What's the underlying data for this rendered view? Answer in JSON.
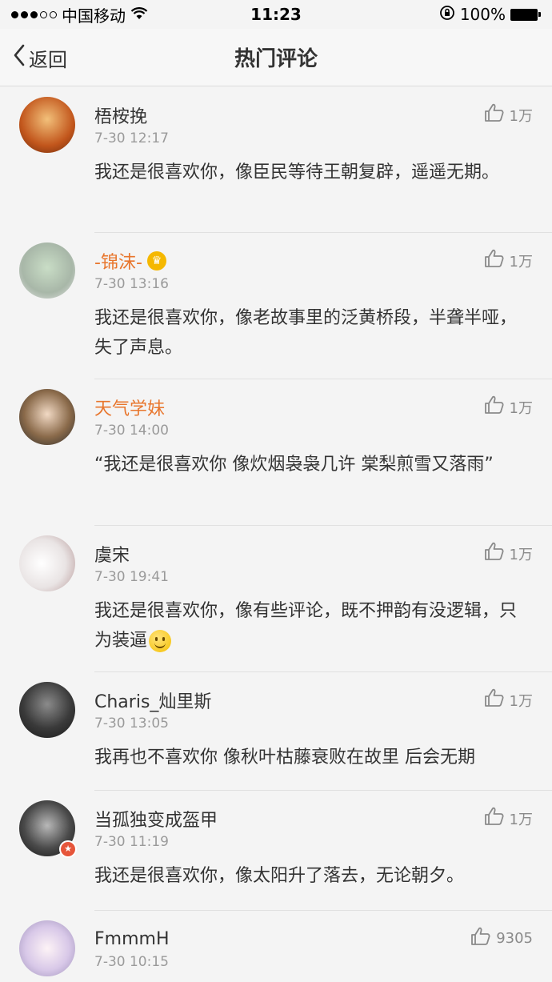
{
  "status_bar": {
    "carrier": "中国移动",
    "time": "11:23",
    "battery": "100%",
    "signal_icon": "signal-dots-icon",
    "wifi_icon": "wifi-icon",
    "lock_icon": "rotation-lock-icon"
  },
  "nav": {
    "back_label": "返回",
    "title": "热门评论"
  },
  "colors": {
    "vip_name": "#e8762d",
    "text": "#333333",
    "meta": "#9a9a9a"
  },
  "comments": [
    {
      "name": "梧桉挽",
      "vip": false,
      "time": "7-30 12:17",
      "likes": "1万",
      "text": "我还是很喜欢你，像臣民等待王朝复辟，遥遥无期。"
    },
    {
      "name": "-锦沫-",
      "vip": true,
      "crown": true,
      "time": "7-30 13:16",
      "likes": "1万",
      "text": "我还是很喜欢你，像老故事里的泛黄桥段，半聋半哑，失了声息。"
    },
    {
      "name": "天气学妹",
      "vip": true,
      "time": "7-30 14:00",
      "likes": "1万",
      "text": "“我还是很喜欢你 像炊烟袅袅几许 棠梨煎雪又落雨”"
    },
    {
      "name": "虞宋",
      "vip": false,
      "time": "7-30 19:41",
      "likes": "1万",
      "text": "我还是很喜欢你，像有些评论，既不押韵有没逻辑，只为装逼",
      "emoji": "smile-emoji"
    },
    {
      "name": "Charis_灿里斯",
      "vip": false,
      "time": "7-30 13:05",
      "likes": "1万",
      "text": "我再也不喜欢你 像秋叶枯藤衰败在故里 后会无期"
    },
    {
      "name": "当孤独变成盔甲",
      "vip": false,
      "badge": true,
      "time": "7-30 11:19",
      "likes": "1万",
      "text": "我还是很喜欢你，像太阳升了落去，无论朝夕。"
    },
    {
      "name": "FmmmH",
      "vip": false,
      "time": "7-30 10:15",
      "likes": "9305",
      "text": ""
    }
  ]
}
